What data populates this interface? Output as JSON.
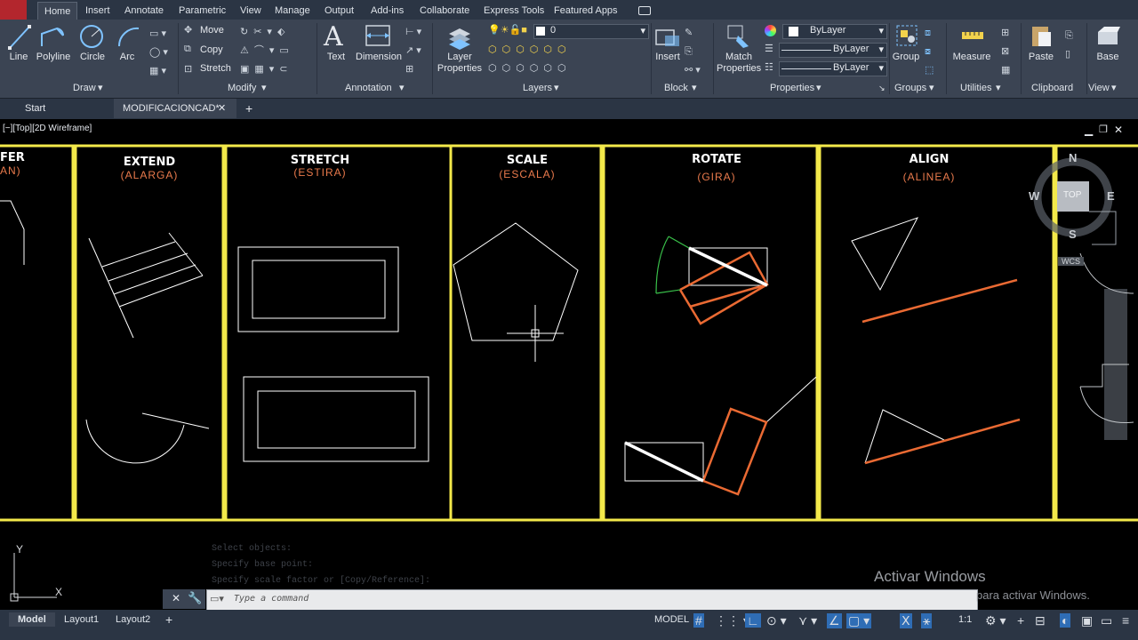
{
  "ribbon_tabs": [
    "Home",
    "Insert",
    "Annotate",
    "Parametric",
    "View",
    "Manage",
    "Output",
    "Add-ins",
    "Collaborate",
    "Express Tools",
    "Featured Apps"
  ],
  "draw": {
    "tools": [
      "Line",
      "Polyline",
      "Circle",
      "Arc"
    ],
    "title": "Draw"
  },
  "modify": {
    "items": [
      "Move",
      "Copy",
      "Stretch"
    ],
    "title": "Modify"
  },
  "annotation": {
    "tools": [
      "Text",
      "Dimension"
    ],
    "title": "Annotation"
  },
  "layers": {
    "tool_line1": "Layer",
    "tool_line2": "Properties",
    "current_layer": "0",
    "title": "Layers"
  },
  "block": {
    "tool": "Insert",
    "title": "Block"
  },
  "properties": {
    "match_line1": "Match",
    "match_line2": "Properties",
    "color": "ByLayer",
    "linetype": "ByLayer",
    "lineweight": "ByLayer",
    "title": "Properties"
  },
  "groups": {
    "tool": "Group",
    "title": "Groups"
  },
  "utilities": {
    "tool": "Measure",
    "title": "Utilities"
  },
  "clipboard": {
    "tool": "Paste",
    "title": "Clipboard"
  },
  "view": {
    "tool": "Base",
    "title": "View"
  },
  "file_tabs": {
    "start": "Start",
    "doc": "MODIFICACIONCAD*"
  },
  "viewport_controls": "[−][Top][2D Wireframe]",
  "panels": [
    {
      "title": "FER",
      "subtitle": "AN)"
    },
    {
      "title": "EXTEND",
      "subtitle": "(ALARGA)"
    },
    {
      "title": "STRETCH",
      "subtitle": "(ESTIRA)"
    },
    {
      "title": "SCALE",
      "subtitle": "(ESCALA)"
    },
    {
      "title": "ROTATE",
      "subtitle": "(GIRA)"
    },
    {
      "title": "ALIGN",
      "subtitle": "(ALINEA)"
    }
  ],
  "viewcube": {
    "n": "N",
    "s": "S",
    "e": "E",
    "w": "W",
    "face": "TOP",
    "ucs": "WCS"
  },
  "command_history": [
    "Select objects:",
    "Specify base point:",
    "Specify scale factor or [Copy/Reference]:"
  ],
  "command_placeholder": "Type a command",
  "layout_tabs": [
    "Model",
    "Layout1",
    "Layout2"
  ],
  "status": {
    "model": "MODEL",
    "scale": "1:1"
  },
  "watermark": {
    "line1": "Activar Windows",
    "line2": "para activar Windows."
  },
  "colors": {
    "ribbon": "#3b4453",
    "tabbar": "#2b3544",
    "frame_yellow": "#f3e94a",
    "orange": "#ea6a33",
    "green": "#39c04a",
    "canvas": "#000000"
  }
}
